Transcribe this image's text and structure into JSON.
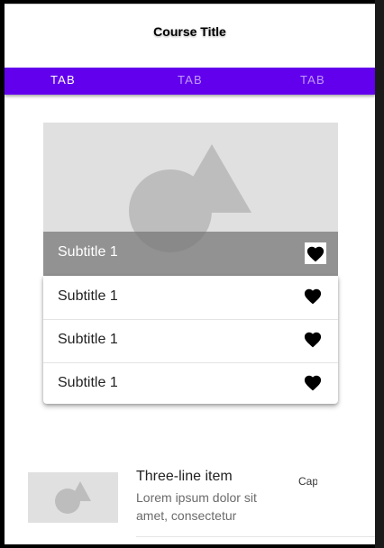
{
  "app_bar": {
    "title": "Course Title"
  },
  "tabs": [
    {
      "label": "TAB",
      "active": true
    },
    {
      "label": "TAB",
      "active": false
    },
    {
      "label": "TAB",
      "active": false
    }
  ],
  "colors": {
    "primary": "#6200ee",
    "placeholder": "#e0e0e0",
    "shape": "#bdbdbd"
  },
  "media_card": {
    "image_icon": "placeholder-shapes-icon",
    "caption": "Subtitle 1",
    "favorite_icon": "heart-icon"
  },
  "menu": {
    "items": [
      {
        "label": "Subtitle 1",
        "icon": "heart-icon"
      },
      {
        "label": "Subtitle 1",
        "icon": "heart-icon"
      },
      {
        "label": "Subtitle 1",
        "icon": "heart-icon"
      }
    ]
  },
  "list": {
    "items": [
      {
        "title": "Three-line item",
        "body": "Lorem ipsum dolor sit amet, consectetur",
        "meta": "Caption",
        "thumbnail_icon": "placeholder-shapes-icon"
      }
    ]
  }
}
